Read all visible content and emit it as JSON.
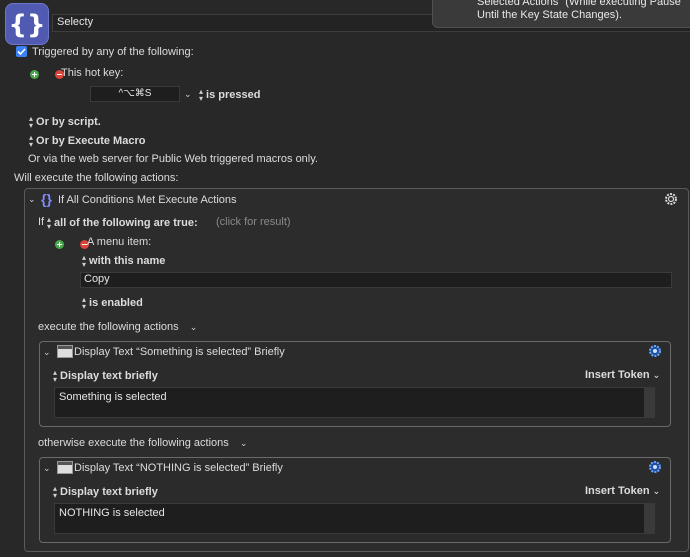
{
  "macro": {
    "name": "Selecty",
    "tooltip_line1": "Selected Actions\" (While executing Pause",
    "tooltip_line2": "Until the Key State Changes)."
  },
  "triggers": {
    "triggered_label": "Triggered by any of the following:",
    "hotkey_label": "This hot key:",
    "hotkey_value": "^⌥⌘S",
    "hotkey_state": "is pressed",
    "or_script": "Or by script.",
    "or_execute_macro": "Or by Execute Macro",
    "or_web": "Or via the web server for Public Web triggered macros only."
  },
  "actions_heading": "Will execute the following actions:",
  "if_action": {
    "title": "If All Conditions Met Execute Actions",
    "if_word": "If",
    "condition_mode": "all of the following are true:",
    "click_result": "(click for result)",
    "menu_item_label": "A menu item:",
    "with_name": "with this name",
    "name_value": "Copy",
    "is_enabled": "is enabled",
    "then_label": "execute the following actions",
    "else_label": "otherwise execute the following actions",
    "then_action": {
      "title": "Display Text “Something is selected” Briefly",
      "mode": "Display text briefly",
      "insert_token": "Insert Token",
      "text": "Something is selected"
    },
    "else_action": {
      "title": "Display Text “NOTHING is selected” Briefly",
      "mode": "Display text briefly",
      "insert_token": "Insert Token",
      "text": "NOTHING is selected"
    }
  },
  "colors": {
    "accent": "#5b8cff",
    "background": "#282828",
    "field": "#1e1e1e"
  },
  "icons": [
    "braces-icon",
    "gear-icon",
    "window-icon",
    "plus-icon",
    "minus-icon",
    "checkbox-icon",
    "chevron-down-icon",
    "updown-icon"
  ]
}
